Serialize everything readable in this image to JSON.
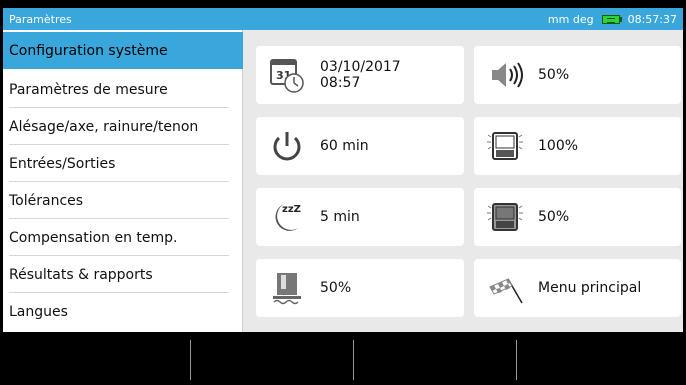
{
  "titlebar": {
    "title": "Paramètres",
    "units": "mm deg",
    "time": "08:57:37"
  },
  "sidebar": {
    "items": [
      {
        "label": "Configuration système",
        "active": true
      },
      {
        "label": "Paramètres de mesure"
      },
      {
        "label": "Alésage/axe, rainure/tenon"
      },
      {
        "label": "Entrées/Sorties"
      },
      {
        "label": "Tolérances"
      },
      {
        "label": "Compensation en temp."
      },
      {
        "label": "Résultats & rapports"
      },
      {
        "label": "Langues"
      }
    ]
  },
  "tiles": {
    "datetime": {
      "date": "03/10/2017",
      "time": "08:57",
      "icon": "calendar-clock-icon",
      "calendar_day": "31"
    },
    "volume": {
      "value": "50%",
      "icon": "speaker-icon"
    },
    "power": {
      "value": "60 min",
      "icon": "power-icon"
    },
    "display_brightness": {
      "value": "100%",
      "icon": "display-brightness-icon"
    },
    "sleep": {
      "value": "5 min",
      "icon": "sleep-moon-icon",
      "icon_text": "zzZ"
    },
    "display_dim": {
      "value": "50%",
      "icon": "display-dim-icon"
    },
    "sensor": {
      "value": "50%",
      "icon": "sensor-icon"
    },
    "main_menu": {
      "label": "Menu principal",
      "icon": "checkered-flag-icon"
    }
  },
  "colors": {
    "accent": "#3aa7dc",
    "panel": "#e9e9e9",
    "battery": "#2fd23a"
  }
}
